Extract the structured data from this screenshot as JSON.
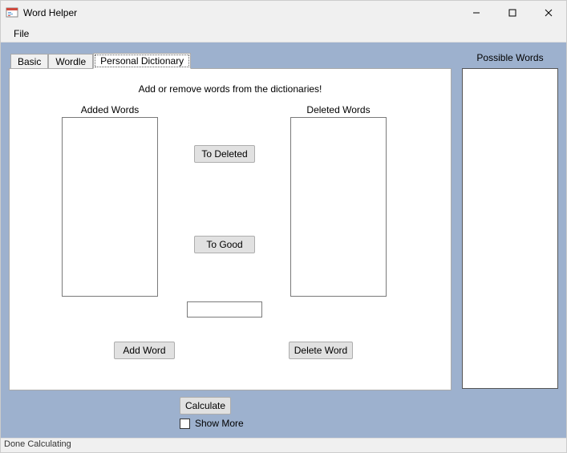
{
  "window": {
    "title": "Word Helper",
    "min_glyph": "—",
    "max_glyph": "☐",
    "close_glyph": "✕"
  },
  "menu": {
    "file": "File"
  },
  "tabs": {
    "basic": "Basic",
    "wordle": "Wordle",
    "personal": "Personal Dictionary"
  },
  "personal": {
    "instruction": "Add or remove words from the dictionaries!",
    "added_label": "Added Words",
    "deleted_label": "Deleted Words",
    "to_deleted": "To Deleted",
    "to_good": "To Good",
    "entry_value": "",
    "add_word": "Add Word",
    "delete_word": "Delete Word",
    "added_items": [],
    "deleted_items": []
  },
  "right": {
    "possible_label": "Possible Words",
    "possible_items": []
  },
  "bottom": {
    "calculate": "Calculate",
    "show_more": "Show More",
    "show_more_checked": false
  },
  "status": {
    "text": "Done Calculating"
  }
}
